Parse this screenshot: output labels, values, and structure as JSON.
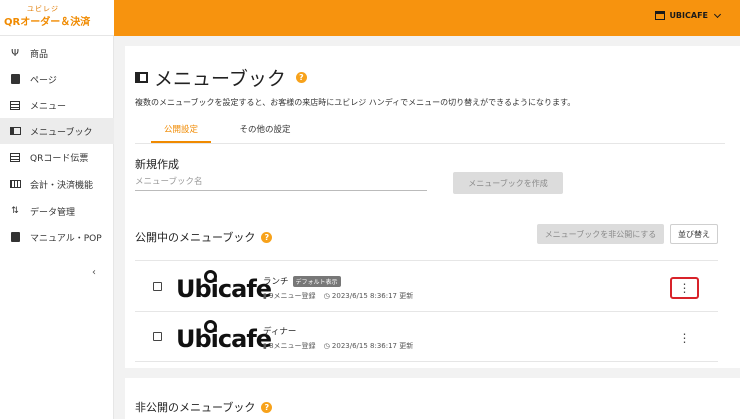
{
  "brand": {
    "small": "ユビレジ",
    "main": "QRオーダー＆決済"
  },
  "header": {
    "store_name": "UBICAFE"
  },
  "sidebar": {
    "items": [
      {
        "label": "商品",
        "icon": "fork-knife-icon"
      },
      {
        "label": "ページ",
        "icon": "document-icon"
      },
      {
        "label": "メニュー",
        "icon": "menu-list-icon"
      },
      {
        "label": "メニューブック",
        "icon": "menu-book-icon",
        "active": true
      },
      {
        "label": "QRコード伝票",
        "icon": "receipt-icon"
      },
      {
        "label": "会計・決済機能",
        "icon": "payment-icon"
      },
      {
        "label": "データ管理",
        "icon": "sort-arrows-icon"
      },
      {
        "label": "マニュアル・POP",
        "icon": "manual-icon"
      }
    ],
    "collapse_glyph": "‹"
  },
  "main": {
    "title": "メニューブック",
    "description": "複数のメニューブックを設定すると、お客様の来店時にユビレジ ハンディでメニューの切り替えができるようになります。",
    "tabs": [
      {
        "label": "公開設定",
        "active": true
      },
      {
        "label": "その他の設定",
        "active": false
      }
    ],
    "create": {
      "heading": "新規作成",
      "input_placeholder": "メニューブック名",
      "input_value": "",
      "button": "メニューブックを作成"
    },
    "published": {
      "heading": "公開中のメニューブック",
      "unpublish_button": "メニューブックを非公開にする",
      "sort_button": "並び替え",
      "books": [
        {
          "name": "ランチ",
          "badge": "デフォルト表示",
          "menu_count": "9メニュー登録",
          "updated": "2023/6/15 8:36:17 更新",
          "logo": "Ubicafe"
        },
        {
          "name": "ディナー",
          "badge": "",
          "menu_count": "8メニュー登録",
          "updated": "2023/6/15 8:36:17 更新",
          "logo": "Ubicafe"
        }
      ]
    },
    "unpublished": {
      "heading": "非公開のメニューブック"
    }
  },
  "icons": {
    "help": "?",
    "more": "⋮",
    "clock": "◷",
    "book": "▮"
  },
  "colors": {
    "accent": "#f7930e",
    "highlight": "#d8232a"
  }
}
